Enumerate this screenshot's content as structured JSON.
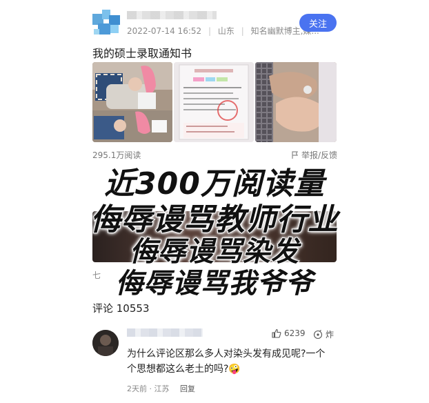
{
  "post": {
    "meta_date": "2022-07-14 16:52",
    "meta_region": "山东",
    "meta_role": "知名幽默博主,媒...",
    "follow_label": "关注",
    "title": "我的硕士录取通知书",
    "read_count": "295.1万阅读",
    "report_label": "举报/反馈",
    "hidden_label": "七"
  },
  "overlay": {
    "line1": "近300万阅读量",
    "line2": "侮辱谩骂教师行业",
    "line3": "侮辱谩骂染发",
    "line4": "侮辱谩骂我爷爷"
  },
  "comments": {
    "count_label": "评论 10553",
    "item": {
      "likes": "6239",
      "fry_label": "炸",
      "text": "为什么评论区那么多人对染头发有成见呢?一个个思想都这么老土的吗?🤪",
      "time_location": "2天前 · 江苏",
      "reply_label": "回复"
    }
  },
  "colors": {
    "accent": "#4a73f0",
    "muted": "#8a8a8a"
  }
}
